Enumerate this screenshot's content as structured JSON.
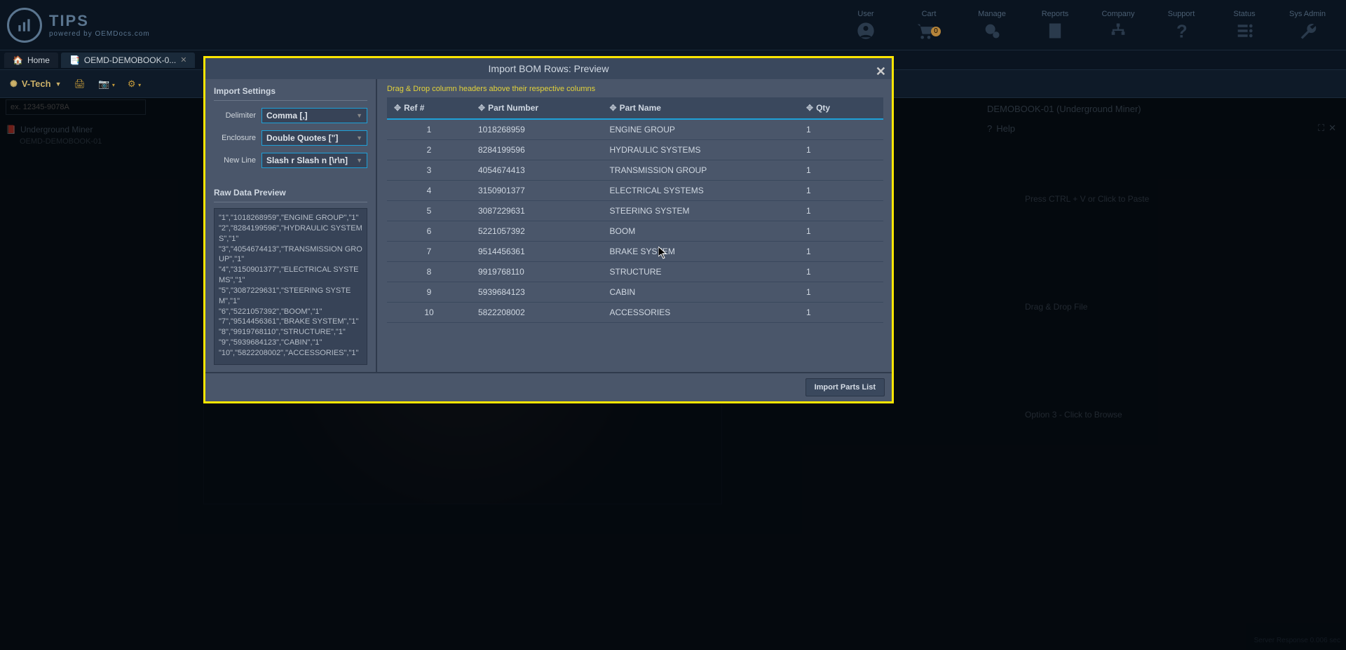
{
  "header": {
    "logo_title": "TIPS",
    "logo_sub": "powered by OEMDocs.com",
    "nav": [
      {
        "label": "User"
      },
      {
        "label": "Cart",
        "badge": "0"
      },
      {
        "label": "Manage"
      },
      {
        "label": "Reports"
      },
      {
        "label": "Company"
      },
      {
        "label": "Support"
      },
      {
        "label": "Status"
      },
      {
        "label": "Sys Admin"
      }
    ]
  },
  "tabs": {
    "home": "Home",
    "second": "OEMD-DEMOBOOK-0..."
  },
  "toolbar": {
    "company": "V-Tech"
  },
  "bg": {
    "search_placeholder": "ex. 12345-9078A",
    "tree": {
      "title": "Underground Miner",
      "sub": "OEMD-DEMOBOOK-01"
    },
    "right_title": "DEMOBOOK-01 (Underground Miner)",
    "help": "Help",
    "opt1": "Press CTRL + V or Click to Paste",
    "opt2": "Drag & Drop File",
    "opt3": "Option 3 - Click to Browse",
    "server": "Server Response 0.006 sec"
  },
  "modal": {
    "title": "Import BOM Rows: Preview",
    "settings_heading": "Import Settings",
    "delimiter_label": "Delimiter",
    "delimiter_value": "Comma [,]",
    "enclosure_label": "Enclosure",
    "enclosure_value": "Double Quotes [\"]",
    "newline_label": "New Line",
    "newline_value": "Slash r Slash n [\\r\\n]",
    "raw_heading": "Raw Data Preview",
    "raw_text": "\"1\",\"1018268959\",\"ENGINE GROUP\",\"1\"\n\"2\",\"8284199596\",\"HYDRAULIC SYSTEMS\",\"1\"\n\"3\",\"4054674413\",\"TRANSMISSION GROUP\",\"1\"\n\"4\",\"3150901377\",\"ELECTRICAL SYSTEMS\",\"1\"\n\"5\",\"3087229631\",\"STEERING SYSTEM\",\"1\"\n\"6\",\"5221057392\",\"BOOM\",\"1\"\n\"7\",\"9514456361\",\"BRAKE SYSTEM\",\"1\"\n\"8\",\"9919768110\",\"STRUCTURE\",\"1\"\n\"9\",\"5939684123\",\"CABIN\",\"1\"\n\"10\",\"5822208002\",\"ACCESSORIES\",\"1\"",
    "preview_hint": "Drag & Drop column headers above their respective columns",
    "columns": {
      "ref": "Ref #",
      "part": "Part Number",
      "name": "Part Name",
      "qty": "Qty"
    },
    "rows": [
      {
        "ref": "1",
        "part": "1018268959",
        "name": "ENGINE GROUP",
        "qty": "1"
      },
      {
        "ref": "2",
        "part": "8284199596",
        "name": "HYDRAULIC SYSTEMS",
        "qty": "1"
      },
      {
        "ref": "3",
        "part": "4054674413",
        "name": "TRANSMISSION GROUP",
        "qty": "1"
      },
      {
        "ref": "4",
        "part": "3150901377",
        "name": "ELECTRICAL SYSTEMS",
        "qty": "1"
      },
      {
        "ref": "5",
        "part": "3087229631",
        "name": "STEERING SYSTEM",
        "qty": "1"
      },
      {
        "ref": "6",
        "part": "5221057392",
        "name": "BOOM",
        "qty": "1"
      },
      {
        "ref": "7",
        "part": "9514456361",
        "name": "BRAKE SYSTEM",
        "qty": "1"
      },
      {
        "ref": "8",
        "part": "9919768110",
        "name": "STRUCTURE",
        "qty": "1"
      },
      {
        "ref": "9",
        "part": "5939684123",
        "name": "CABIN",
        "qty": "1"
      },
      {
        "ref": "10",
        "part": "5822208002",
        "name": "ACCESSORIES",
        "qty": "1"
      }
    ],
    "import_btn": "Import Parts List"
  }
}
